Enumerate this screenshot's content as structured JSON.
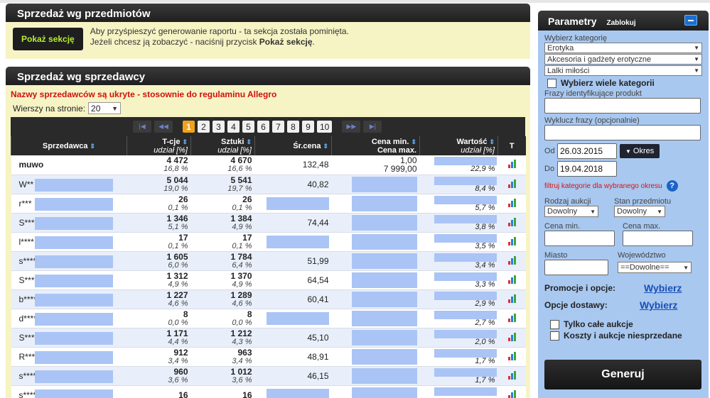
{
  "section1": {
    "title": "Sprzedaż wg przedmiotów",
    "button": "Pokaż sekcję",
    "info_line1": "Aby przyśpieszyć generowanie raportu - ta sekcja została pominięta.",
    "info_line2a": "Jeżeli chcesz ją zobaczyć - naciśnij przycisk ",
    "info_line2b": "Pokaż sekcję",
    "info_line2c": "."
  },
  "section2": {
    "title": "Sprzedaż wg sprzedawcy",
    "warning": "Nazwy sprzedawców są ukryte - stosownie do regulaminu Allegro",
    "rows_label": "Wierszy na stronie:",
    "rows_value": "20",
    "pages": [
      "1",
      "2",
      "3",
      "4",
      "5",
      "6",
      "7",
      "8",
      "9",
      "10"
    ],
    "active_page": "1",
    "columns": {
      "seller": "Sprzedawca",
      "tcje": "T-cje",
      "tcje_sub": "udział [%]",
      "sztuki": "Sztuki",
      "sztuki_sub": "udział [%]",
      "avg": "Śr.cena",
      "minmax1": "Cena min.",
      "minmax2": "Cena max.",
      "value": "Wartość",
      "value_sub": "udział [%]",
      "t": "T"
    },
    "rows": [
      {
        "name": "muwo",
        "t": "4 472",
        "tp": "16,8 %",
        "s": "4 670",
        "sp": "16,6 %",
        "avg": "132,48",
        "min": "1,00",
        "max": "7 999,00",
        "vp": "22,9 %"
      },
      {
        "name": "W**",
        "t": "5 044",
        "tp": "19,0 %",
        "s": "5 541",
        "sp": "19,7 %",
        "avg": "40,82",
        "min": "",
        "max": "",
        "vp": "8,4 %"
      },
      {
        "name": "r***",
        "t": "26",
        "tp": "0,1 %",
        "s": "26",
        "sp": "0,1 %",
        "avg": "",
        "min": "",
        "max": "",
        "vp": "5,7 %"
      },
      {
        "name": "S***",
        "t": "1 346",
        "tp": "5,1 %",
        "s": "1 384",
        "sp": "4,9 %",
        "avg": "74,44",
        "min": "",
        "max": "",
        "vp": "3,8 %"
      },
      {
        "name": "l****",
        "t": "17",
        "tp": "0,1 %",
        "s": "17",
        "sp": "0,1 %",
        "avg": "",
        "min": "",
        "max": "",
        "vp": "3,5 %"
      },
      {
        "name": "s****",
        "t": "1 605",
        "tp": "6,0 %",
        "s": "1 784",
        "sp": "6,4 %",
        "avg": "51,99",
        "min": "",
        "max": "",
        "vp": "3,4 %"
      },
      {
        "name": "S***",
        "t": "1 312",
        "tp": "4,9 %",
        "s": "1 370",
        "sp": "4,9 %",
        "avg": "64,54",
        "min": "",
        "max": "",
        "vp": "3,3 %"
      },
      {
        "name": "b****",
        "t": "1 227",
        "tp": "4,6 %",
        "s": "1 289",
        "sp": "4,6 %",
        "avg": "60,41",
        "min": "",
        "max": "",
        "vp": "2,9 %"
      },
      {
        "name": "d****",
        "t": "8",
        "tp": "0,0 %",
        "s": "8",
        "sp": "0,0 %",
        "avg": "",
        "min": "",
        "max": "",
        "vp": "2,7 %"
      },
      {
        "name": "S****",
        "t": "1 171",
        "tp": "4,4 %",
        "s": "1 212",
        "sp": "4,3 %",
        "avg": "45,10",
        "min": "",
        "max": "",
        "vp": "2,0 %"
      },
      {
        "name": "R****",
        "t": "912",
        "tp": "3,4 %",
        "s": "963",
        "sp": "3,4 %",
        "avg": "48,91",
        "min": "",
        "max": "",
        "vp": "1,7 %"
      },
      {
        "name": "s****",
        "t": "960",
        "tp": "3,6 %",
        "s": "1 012",
        "sp": "3,6 %",
        "avg": "46,15",
        "min": "",
        "max": "",
        "vp": "1,7 %"
      },
      {
        "name": "s****",
        "t": "16",
        "tp": "",
        "s": "16",
        "sp": "",
        "avg": "",
        "min": "",
        "max": "",
        "vp": ""
      }
    ]
  },
  "sidebar": {
    "title": "Parametry",
    "lock": "Zablokuj",
    "choose_category": "Wybierz kategorię",
    "cat1": "Erotyka",
    "cat2": "Akcesoria i gadżety erotyczne",
    "cat3": "Lalki miłości",
    "multi_cat": "Wybierz wiele kategorii",
    "phrases": "Frazy identyfikujące produkt",
    "exclude": "Wyklucz frazy (opcjonalnie)",
    "from_label": "Od",
    "from_value": "26.03.2015",
    "to_label": "Do",
    "to_value": "19.04.2018",
    "period_button": "Okres",
    "filter_text": "filtruj kategorie dla wybranego okresu",
    "auction_type": "Rodzaj aukcji",
    "auction_value": "Dowolny",
    "item_state": "Stan przedmiotu",
    "state_value": "Dowolny",
    "price_min": "Cena min.",
    "price_max": "Cena max.",
    "city": "Miasto",
    "voivodeship": "Województwo",
    "voivodeship_value": "==Dowolne==",
    "promo": "Promocje i opcje:",
    "promo_link": "Wybierz",
    "delivery": "Opcje dostawy:",
    "delivery_link": "Wybierz",
    "only_full": "Tylko całe aukcje",
    "costs": "Koszty i aukcje niesprzedane",
    "generate": "Generuj"
  }
}
